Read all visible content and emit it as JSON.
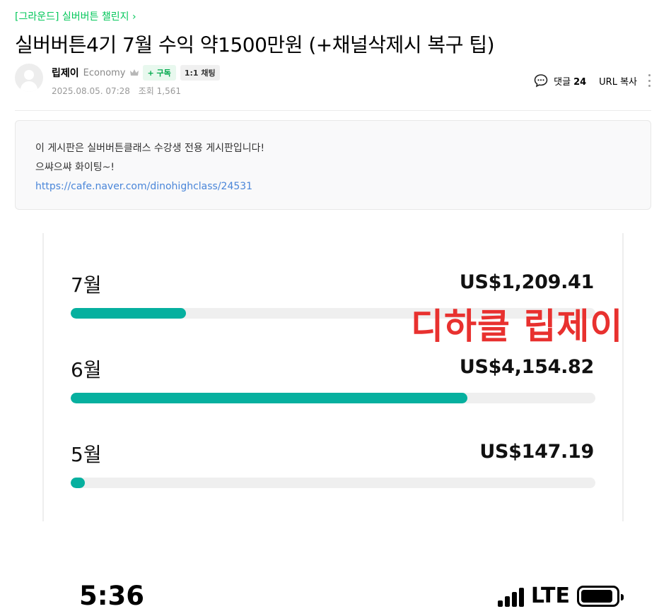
{
  "post": {
    "board_link": "[그라운드] 실버버튼 챌린지 ›",
    "title": "실버버튼4기 7월 수익 약1500만원 (+채널삭제시 복구 팁)",
    "author": {
      "name": "립제이",
      "level": "Economy",
      "subscribe_label": "+ 구독",
      "chat_label": "1:1 채팅"
    },
    "meta": {
      "date": "2025.08.05. 07:28",
      "views_label": "조회 1,561"
    },
    "tools": {
      "comment_label": "댓글",
      "comment_count": "24",
      "url_copy_label": "URL 복사"
    }
  },
  "notice": {
    "line1": "이 게시판은 실버버튼클래스 수강생 전용 게시판입니다!",
    "line2": "으쌰으쌰 화이팅~!",
    "link": "https://cafe.naver.com/dinohighclass/24531"
  },
  "earnings_image": {
    "watermark": "디하클 립제이",
    "rows": [
      {
        "month": "7월",
        "amount": "US$1,209.41",
        "progress": 0.22
      },
      {
        "month": "6월",
        "amount": "US$4,154.82",
        "progress": 0.756
      },
      {
        "month": "5월",
        "amount": "US$147.19",
        "progress": 0.027
      }
    ],
    "status_bar": {
      "time": "5:36",
      "network": "LTE",
      "battery_level": 0.92
    }
  },
  "colors": {
    "accent_green": "#03c75a",
    "bar_fill": "#06b09f",
    "watermark_red": "#e8312f",
    "link_blue": "#4a86d9"
  },
  "icons": [
    "avatar-placeholder",
    "crown-icon",
    "comment-icon",
    "more-icon",
    "signal-icon",
    "battery-icon"
  ]
}
